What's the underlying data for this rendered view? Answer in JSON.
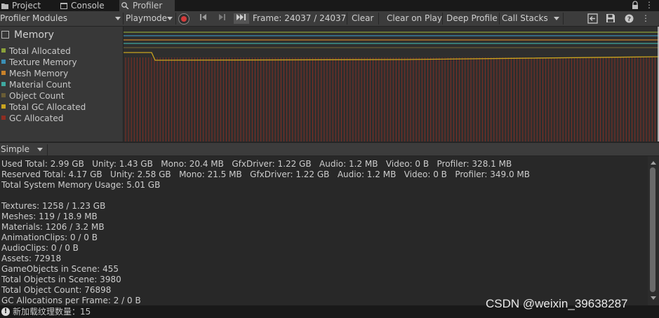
{
  "tabs": [
    {
      "label": "Project",
      "icon": "folder-icon"
    },
    {
      "label": "Console",
      "icon": "console-icon"
    },
    {
      "label": "Profiler",
      "icon": "profiler-icon"
    }
  ],
  "toolbar": {
    "modules_dropdown": "Profiler Modules",
    "playmode_dropdown": "Playmode",
    "frame_label": "Frame: 24037 / 24037",
    "clear": "Clear",
    "clear_on_play": "Clear on Play",
    "deep_profile": "Deep Profile",
    "call_stacks": "Call Stacks"
  },
  "module": {
    "title": "Memory",
    "legend": [
      {
        "label": "Total Allocated",
        "color": "#8ba13a"
      },
      {
        "label": "Texture Memory",
        "color": "#3b8fb5"
      },
      {
        "label": "Mesh Memory",
        "color": "#c9822a"
      },
      {
        "label": "Material Count",
        "color": "#3fa9a0"
      },
      {
        "label": "Object Count",
        "color": "#6a5d35"
      },
      {
        "label": "Total GC Allocated",
        "color": "#c9a41f"
      },
      {
        "label": "GC Allocated",
        "color": "#8f2e22"
      }
    ]
  },
  "view": {
    "mode": "Simple"
  },
  "details": {
    "lines": [
      "Used Total: 2.99 GB   Unity: 1.43 GB   Mono: 20.4 MB   GfxDriver: 1.22 GB   Audio: 1.2 MB   Video: 0 B   Profiler: 328.1 MB",
      "Reserved Total: 4.17 GB   Unity: 2.58 GB   Mono: 21.5 MB   GfxDriver: 1.22 GB   Audio: 1.2 MB   Video: 0 B   Profiler: 349.0 MB",
      "Total System Memory Usage: 5.01 GB",
      "",
      "Textures: 1258 / 1.23 GB",
      "Meshes: 119 / 18.9 MB",
      "Materials: 1206 / 3.2 MB",
      "AnimationClips: 0 / 0 B",
      "AudioClips: 0 / 0 B",
      "Assets: 72918",
      "GameObjects in Scene: 455",
      "Total Objects in Scene: 3980",
      "Total Object Count: 76898",
      "GC Allocations per Frame: 2 / 0 B"
    ]
  },
  "status": {
    "message": "新加载纹理数量：15",
    "icon": "warning-icon"
  },
  "watermark": "CSDN @weixin_39638287"
}
